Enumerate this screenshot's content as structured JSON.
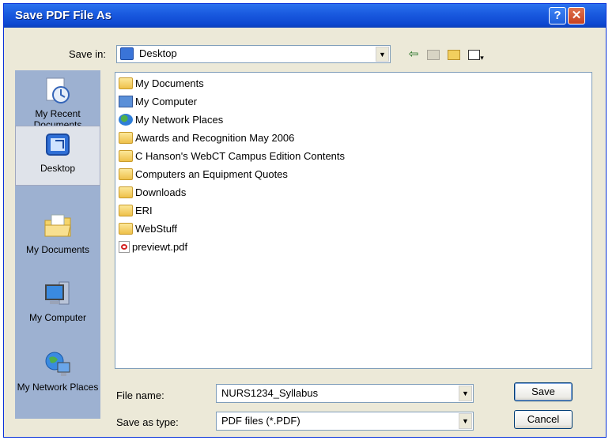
{
  "window": {
    "title": "Save PDF File As",
    "help_glyph": "?",
    "close_glyph": "✕"
  },
  "toolbar": {
    "save_in_label": "Save in:",
    "save_in_value": "Desktop",
    "icons": [
      "back-icon",
      "up-folder-icon",
      "new-folder-icon",
      "view-menu-icon"
    ]
  },
  "places": [
    {
      "label": "My Recent Documents",
      "icon": "recent-documents-icon",
      "selected": false
    },
    {
      "label": "Desktop",
      "icon": "desktop-icon",
      "selected": true
    },
    {
      "label": "My Documents",
      "icon": "my-documents-icon",
      "selected": false
    },
    {
      "label": "My Computer",
      "icon": "my-computer-icon",
      "selected": false
    },
    {
      "label": "My Network Places",
      "icon": "network-places-icon",
      "selected": false
    }
  ],
  "files": [
    {
      "name": "My Documents",
      "icon": "my-documents-icon"
    },
    {
      "name": "My Computer",
      "icon": "my-computer-icon"
    },
    {
      "name": "My Network Places",
      "icon": "network-places-icon"
    },
    {
      "name": "Awards and Recognition May 2006",
      "icon": "folder-icon"
    },
    {
      "name": "C Hanson's WebCT Campus Edition Contents",
      "icon": "folder-icon"
    },
    {
      "name": "Computers an Equipment Quotes",
      "icon": "folder-icon"
    },
    {
      "name": "Downloads",
      "icon": "folder-icon"
    },
    {
      "name": "ERI",
      "icon": "folder-icon"
    },
    {
      "name": "WebStuff",
      "icon": "folder-icon"
    },
    {
      "name": "previewt.pdf",
      "icon": "pdf-file-icon"
    }
  ],
  "form": {
    "file_name_label": "File name:",
    "file_name_value": "NURS1234_Syllabus",
    "type_label": "Save as type:",
    "type_value": "PDF files (*.PDF)",
    "save_label": "Save",
    "cancel_label": "Cancel"
  },
  "colors": {
    "title_bar": "#0d48d1",
    "places_bar": "#9db1d1",
    "dialog_bg": "#ece9d8"
  }
}
